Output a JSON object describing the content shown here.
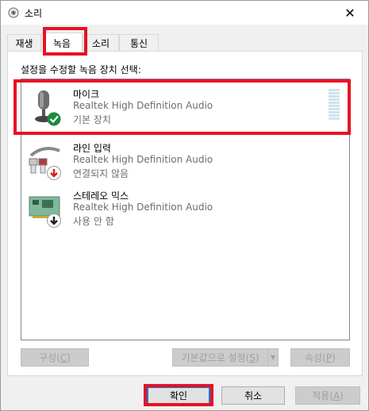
{
  "window": {
    "title": "소리",
    "close_glyph": "✕"
  },
  "tabs": [
    {
      "label": "재생",
      "active": false
    },
    {
      "label": "녹음",
      "active": true
    },
    {
      "label": "소리",
      "active": false
    },
    {
      "label": "통신",
      "active": false
    }
  ],
  "panel": {
    "instruction": "설정을 수정할 녹음 장치 선택:"
  },
  "devices": [
    {
      "name": "마이크",
      "driver": "Realtek High Definition Audio",
      "status": "기본 장치",
      "icon": "microphone-icon",
      "badge": "check-badge-icon",
      "badge_color": "#1e8a3a",
      "selected": true
    },
    {
      "name": "라인 입력",
      "driver": "Realtek High Definition Audio",
      "status": "연결되지 않음",
      "icon": "line-in-cable-icon",
      "badge": "red-down-arrow-icon",
      "badge_color": "#d42121",
      "selected": false
    },
    {
      "name": "스테레오 믹스",
      "driver": "Realtek High Definition Audio",
      "status": "사용 안 함",
      "icon": "sound-card-icon",
      "badge": "black-down-arrow-icon",
      "badge_color": "#222222",
      "selected": false
    }
  ],
  "panel_buttons": {
    "configure": {
      "text": "구성",
      "accel": "C"
    },
    "set_default": {
      "text": "기본값으로 설정",
      "accel": "S"
    },
    "properties": {
      "text": "속성",
      "accel": "P"
    }
  },
  "dialog_buttons": {
    "ok": "확인",
    "cancel": "취소",
    "apply": {
      "text": "적용",
      "accel": "A"
    }
  },
  "colors": {
    "highlight": "#e81123",
    "default_button_border": "#0078d7"
  }
}
